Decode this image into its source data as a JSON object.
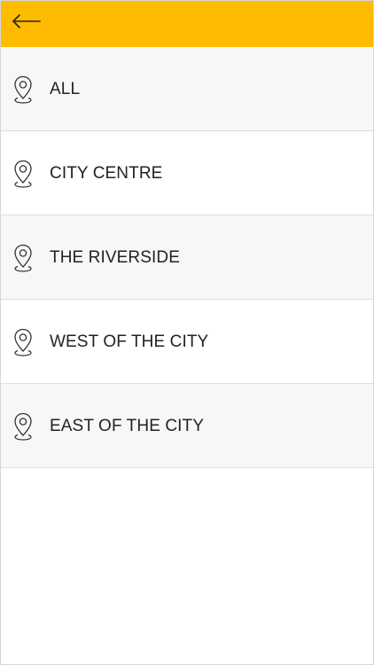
{
  "header": {
    "background": "#ffbb00",
    "back_icon": "arrow-left-icon"
  },
  "locations": [
    {
      "label": "ALL",
      "icon": "map-pin-icon"
    },
    {
      "label": "CITY CENTRE",
      "icon": "map-pin-icon"
    },
    {
      "label": "THE RIVERSIDE",
      "icon": "map-pin-icon"
    },
    {
      "label": "WEST OF THE CITY",
      "icon": "map-pin-icon"
    },
    {
      "label": "EAST OF THE CITY",
      "icon": "map-pin-icon"
    }
  ]
}
